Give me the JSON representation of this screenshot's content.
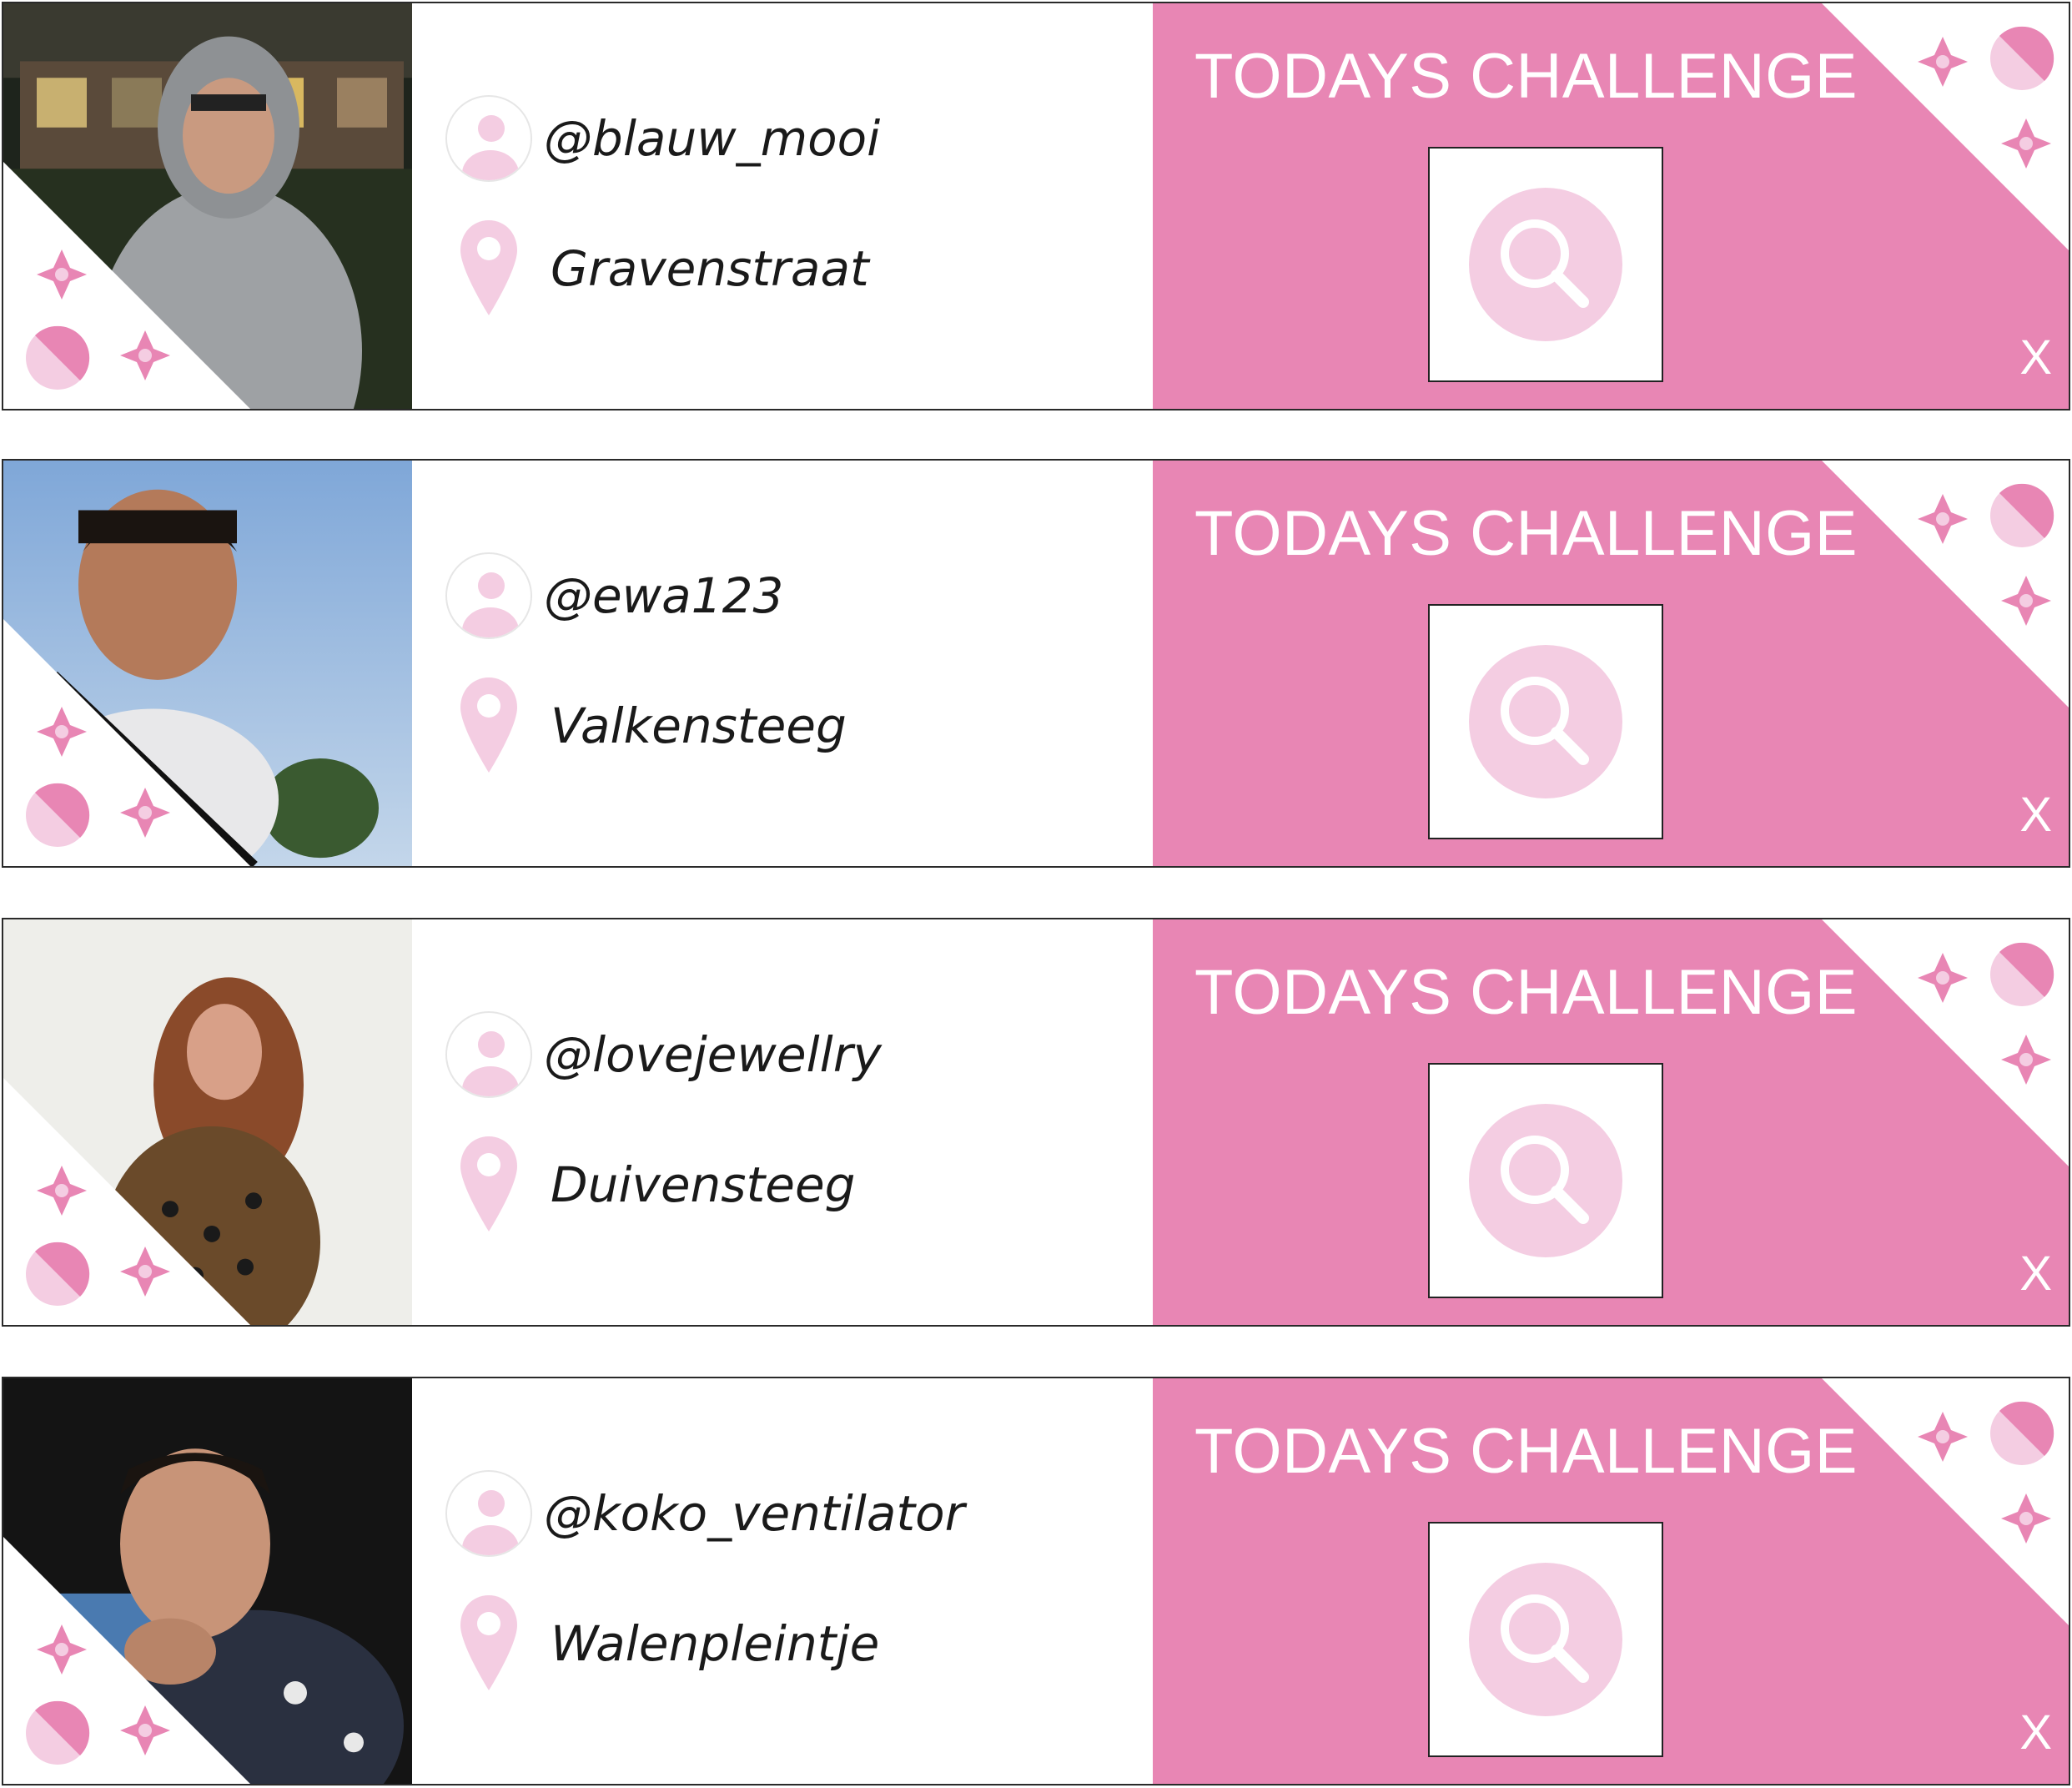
{
  "colors": {
    "accent_pink": "#e886b4",
    "light_pink": "#f4cde2",
    "white": "#ffffff"
  },
  "cards": [
    {
      "username": "@blauw_mooi",
      "location": "Gravenstraat",
      "challenge_title": "TODAYS CHALLENGE",
      "close_label": "X",
      "photo_scene": "night-street"
    },
    {
      "username": "@ewa123",
      "location": "Valkensteeg",
      "challenge_title": "TODAYS CHALLENGE",
      "close_label": "X",
      "photo_scene": "blue-sky"
    },
    {
      "username": "@lovejewellry",
      "location": "Duivensteeg",
      "challenge_title": "TODAYS CHALLENGE",
      "close_label": "X",
      "photo_scene": "white-wall"
    },
    {
      "username": "@koko_ventilator",
      "location": "Walenpleintje",
      "challenge_title": "TODAYS CHALLENGE",
      "close_label": "X",
      "photo_scene": "car-interior"
    }
  ],
  "icons": {
    "avatar": "user-avatar-icon",
    "location": "map-pin-icon",
    "search": "search-icon",
    "flower": "flower-icon",
    "half_circle": "half-circle-icon",
    "close": "close-icon"
  }
}
